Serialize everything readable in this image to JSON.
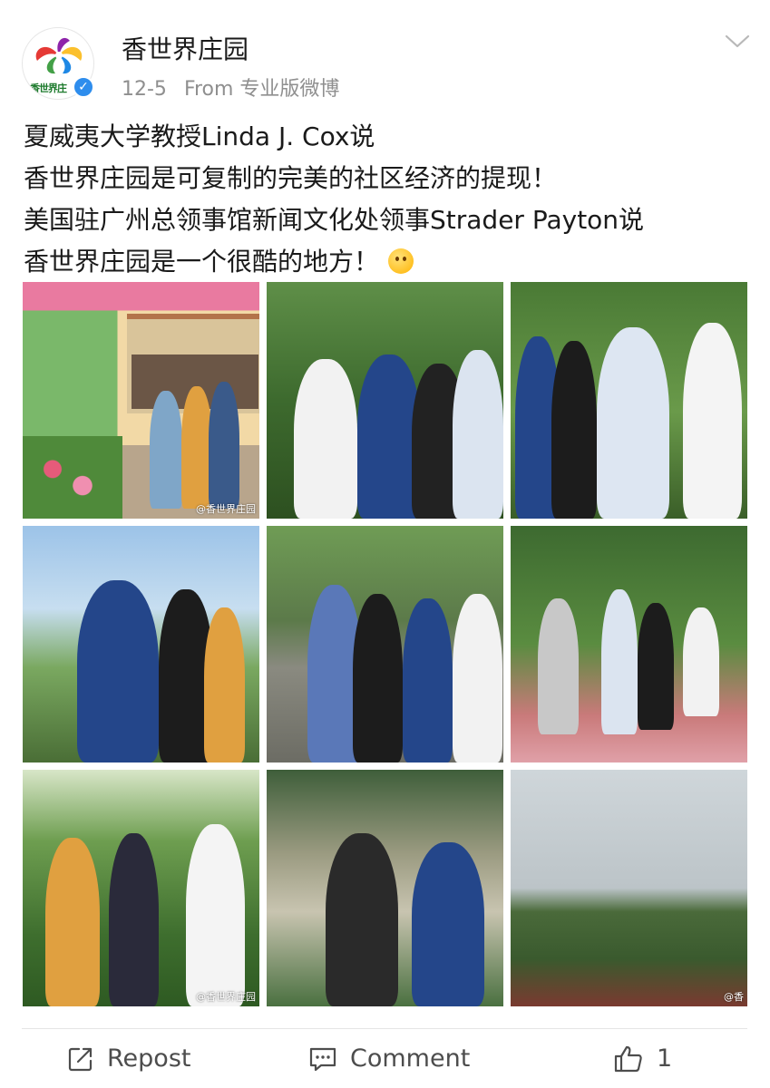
{
  "post": {
    "username": "香世界庄园",
    "avatar_text": "香世界庄",
    "time": "12-5",
    "source": "From 专业版微博",
    "text_lines": [
      "夏威夷大学教授Linda J. Cox说",
      "香世界庄园是可复制的完美的社区经济的提现！",
      "美国驻广州总领事馆新闻文化处领事Strader Payton说",
      "香世界庄园是一个很酷的地方！"
    ],
    "emoji": "smiling-blushing-emoji"
  },
  "photos": {
    "watermarks": [
      "@香世界庄园",
      "@香世界庄园",
      "@香"
    ]
  },
  "actions": {
    "repost_label": "Repost",
    "comment_label": "Comment",
    "like_count": "1"
  },
  "colors": {
    "verified_badge": "#2e8ded",
    "meta_text": "#8f8f8f",
    "action_text": "#4d4d4d"
  },
  "icons": [
    "chevron-down-icon",
    "verified-icon",
    "repost-icon",
    "comment-icon",
    "like-icon"
  ]
}
